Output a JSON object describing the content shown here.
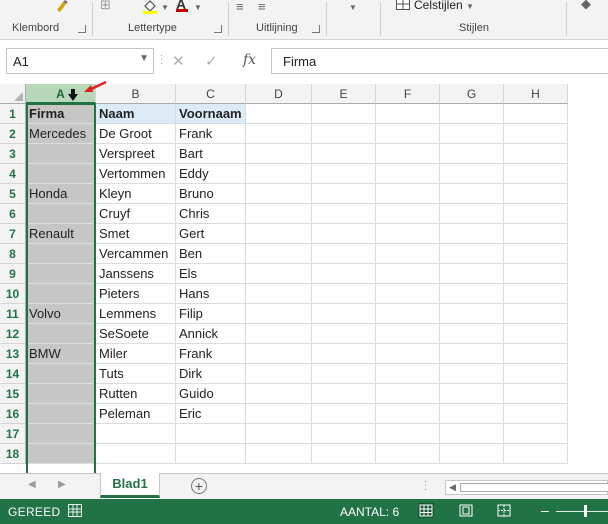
{
  "ribbon": {
    "groups": [
      {
        "label": "Klembord"
      },
      {
        "label": "Lettertype"
      },
      {
        "label": "Uitlijning"
      },
      {
        "label": "Stijlen"
      }
    ],
    "celstijlen_label": "Celstijlen"
  },
  "formula_bar": {
    "name_box": "A1",
    "formula": "Firma",
    "fx_label": "fx"
  },
  "columns": [
    "A",
    "B",
    "C",
    "D",
    "E",
    "F",
    "G",
    "H"
  ],
  "rows": [
    "1",
    "2",
    "3",
    "4",
    "5",
    "6",
    "7",
    "8",
    "9",
    "10",
    "11",
    "12",
    "13",
    "14",
    "15",
    "16",
    "17",
    "18"
  ],
  "cells": [
    [
      "Firma",
      "Naam",
      "Voornaam"
    ],
    [
      "Mercedes",
      "De Groot",
      "Frank"
    ],
    [
      "",
      "Verspreet",
      "Bart"
    ],
    [
      "",
      "Vertommen",
      "Eddy"
    ],
    [
      "Honda",
      "Kleyn",
      "Bruno"
    ],
    [
      "",
      "Cruyf",
      "Chris"
    ],
    [
      "Renault",
      "Smet",
      "Gert"
    ],
    [
      "",
      "Vercammen",
      "Ben"
    ],
    [
      "",
      "Janssens",
      "Els"
    ],
    [
      "",
      "Pieters",
      "Hans"
    ],
    [
      "Volvo",
      "Lemmens",
      "Filip"
    ],
    [
      "",
      "SeSoete",
      "Annick"
    ],
    [
      "BMW",
      "Miler",
      "Frank"
    ],
    [
      "",
      "Tuts",
      "Dirk"
    ],
    [
      "",
      "Rutten",
      "Guido"
    ],
    [
      "",
      "Peleman",
      "Eric"
    ],
    [
      "",
      "",
      ""
    ],
    [
      "",
      "",
      ""
    ]
  ],
  "sheet_tabs": {
    "active": "Blad1"
  },
  "status_bar": {
    "ready": "GEREED",
    "count": "AANTAL: 6"
  },
  "colors": {
    "excel_green": "#217346",
    "selection_fill": "#c6c6c6",
    "header_fill": "#ddebf7",
    "arrow_red": "#e02020"
  },
  "icons": [
    "brush-icon",
    "fill-color-icon",
    "font-color-icon",
    "cell-styles-icon",
    "cancel-icon",
    "confirm-icon",
    "function-icon",
    "add-sheet-icon",
    "normal-view-icon",
    "page-layout-icon",
    "page-break-icon"
  ]
}
